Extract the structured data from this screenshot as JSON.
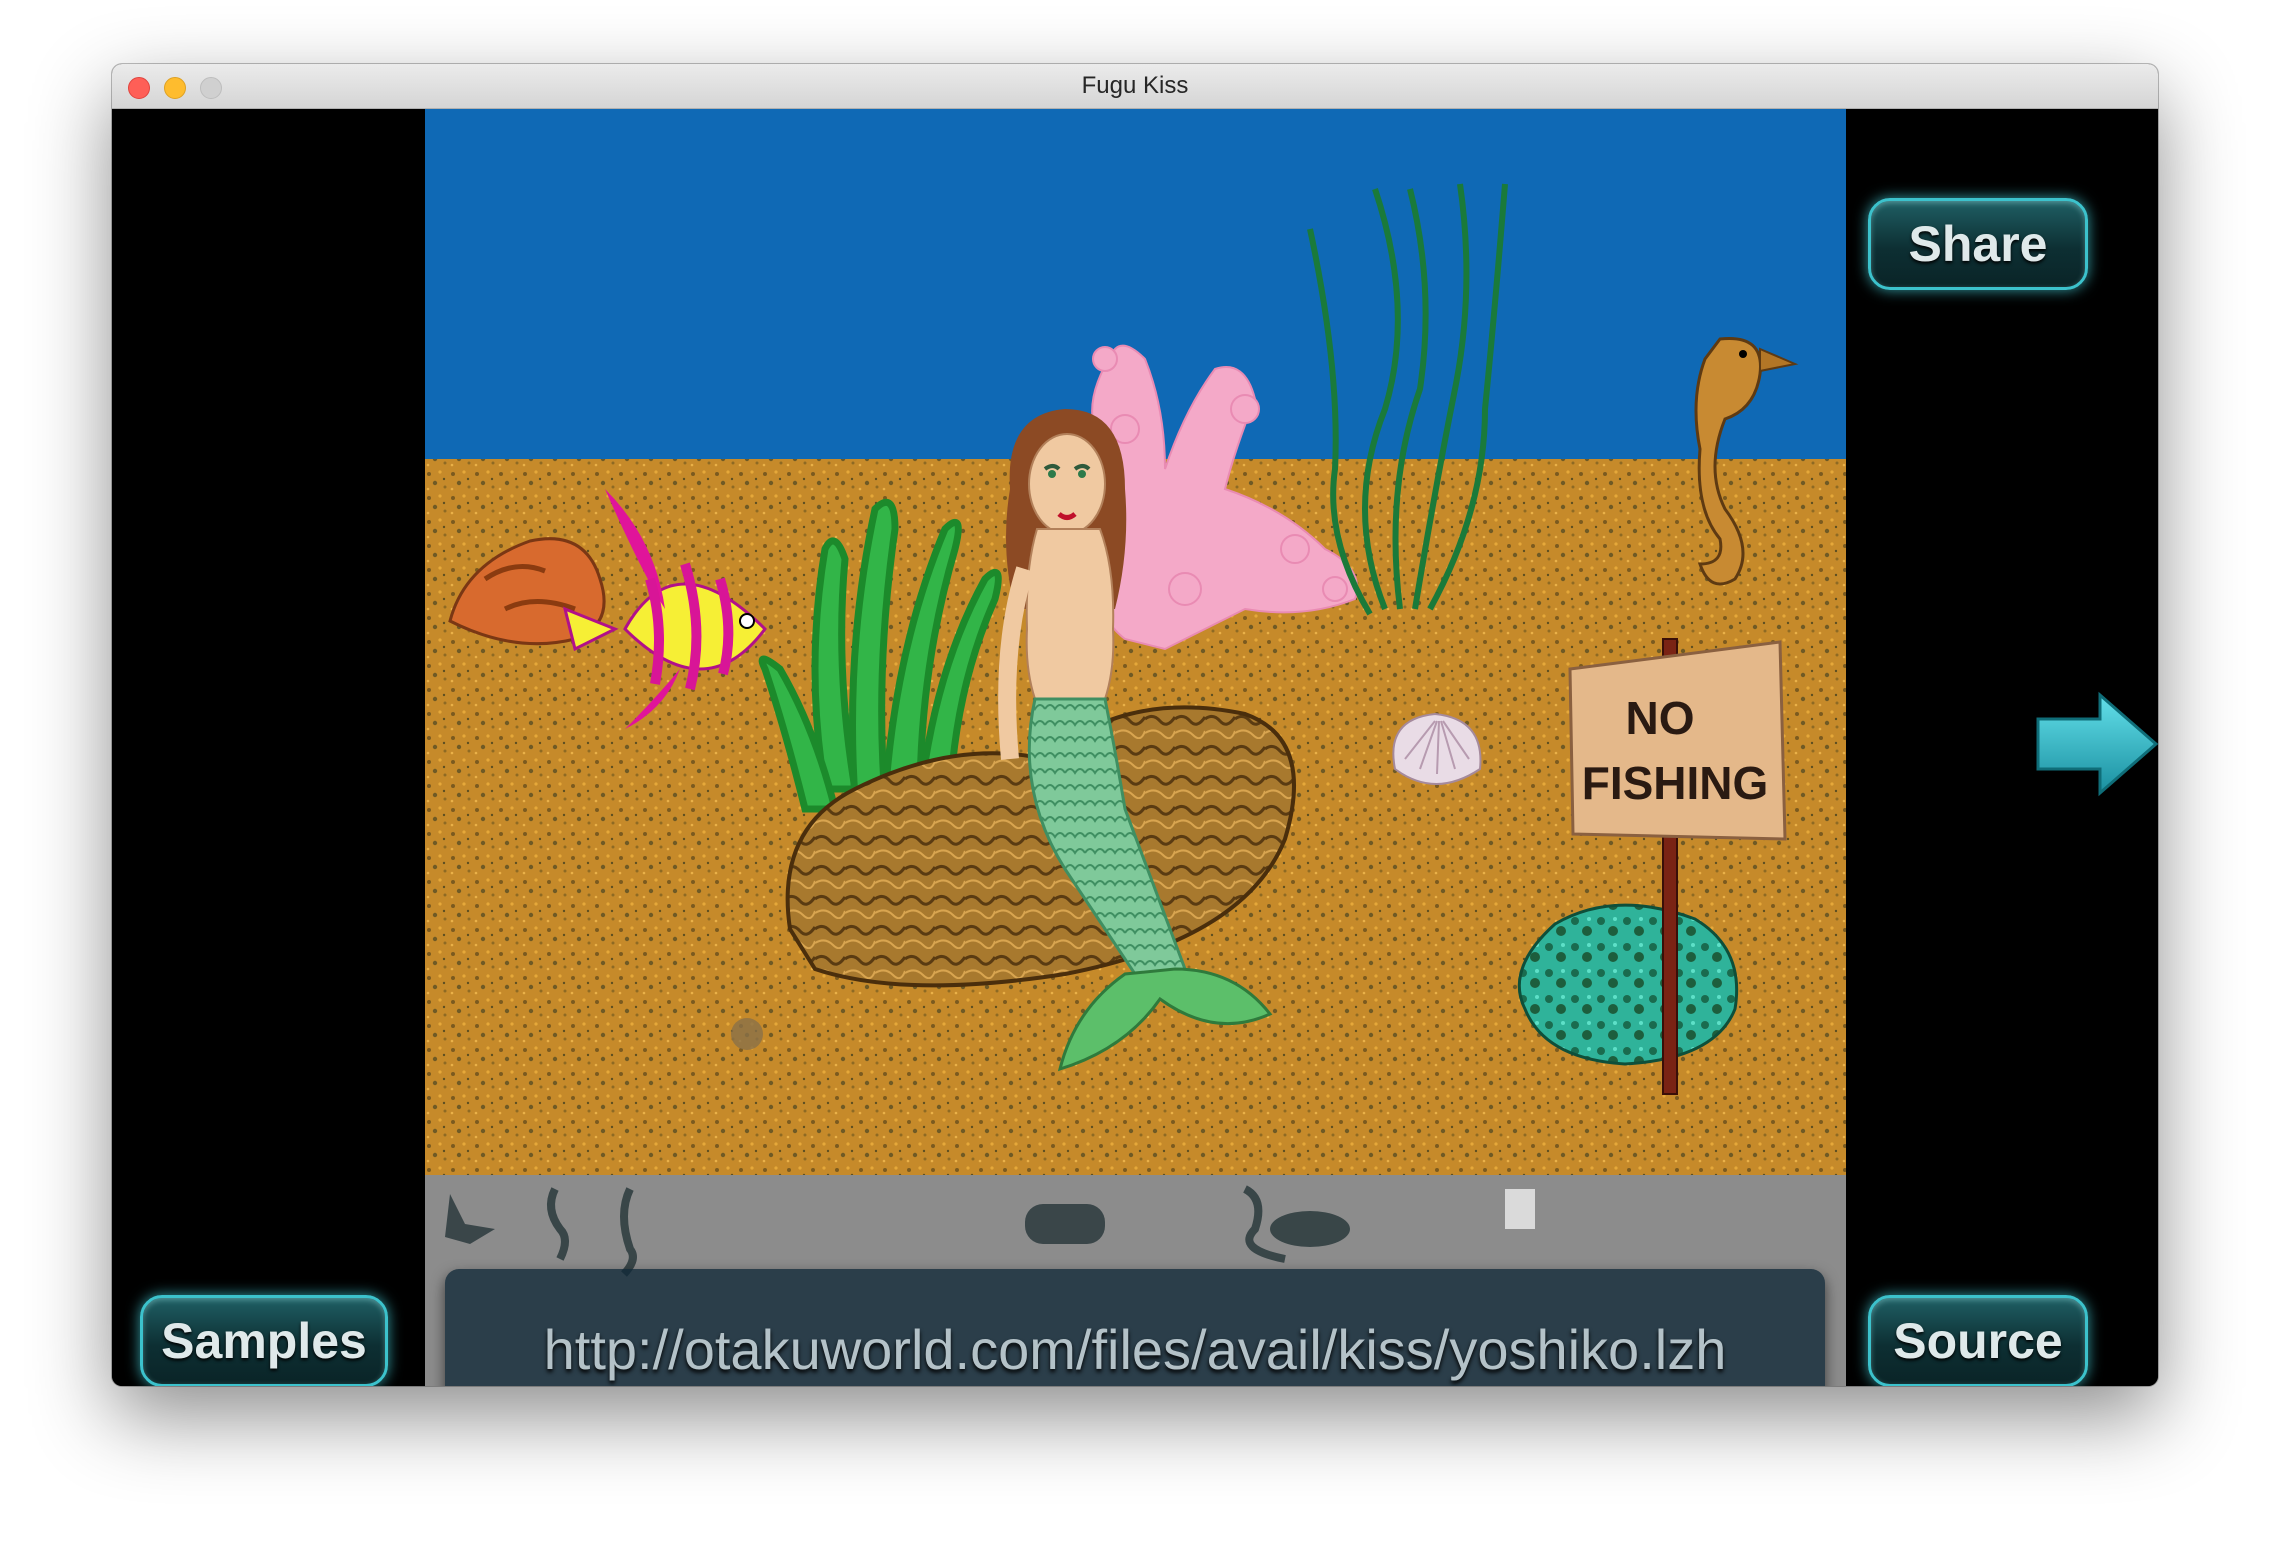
{
  "window": {
    "title": "Fugu Kiss"
  },
  "buttons": {
    "share": "Share",
    "samples": "Samples",
    "source": "Source"
  },
  "url_bar": {
    "value": "http://otakuworld.com/files/avail/kiss/yoshiko.lzh"
  },
  "scene": {
    "sign_line1": "NO",
    "sign_line2": "FISHING"
  },
  "colors": {
    "water": "#0f69b5",
    "sand": "#c68a2a",
    "button_border": "#3cc2cc",
    "arrow": "#27b8c8"
  },
  "icons": [
    "next-arrow-icon",
    "mermaid",
    "angelfish",
    "seahorse",
    "coral",
    "seashell",
    "rock"
  ]
}
